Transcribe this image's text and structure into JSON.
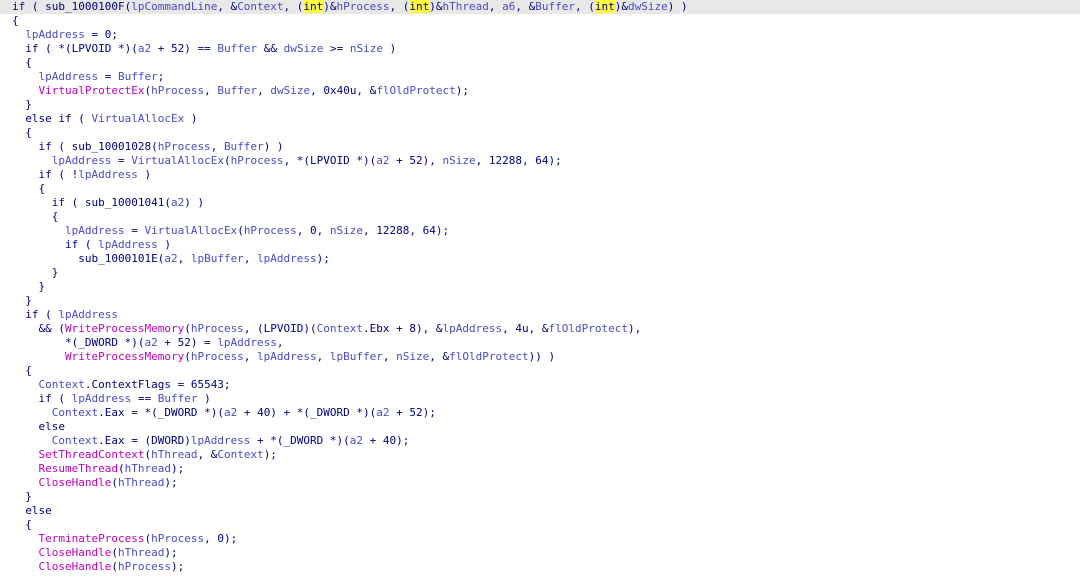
{
  "theme": {
    "background": "#ffffff",
    "current_line_bg": "#e8e8e8",
    "plain_color": "#000080",
    "var_color": "#4a4ac8",
    "func_color": "#c000c0",
    "highlight_bg": "#ffff3a"
  },
  "pseudocode": {
    "lines": [
      {
        "current": true,
        "tokens": [
          {
            "t": "if ( sub_1000100F(",
            "k": "p"
          },
          {
            "t": "lpCommandLine",
            "k": "v"
          },
          {
            "t": ", &",
            "k": "p"
          },
          {
            "t": "Context",
            "k": "v"
          },
          {
            "t": ", (",
            "k": "p"
          },
          {
            "t": "int",
            "k": "h"
          },
          {
            "t": ")&",
            "k": "p"
          },
          {
            "t": "hProcess",
            "k": "v"
          },
          {
            "t": ", (",
            "k": "p"
          },
          {
            "t": "int",
            "k": "h"
          },
          {
            "t": ")&",
            "k": "p"
          },
          {
            "t": "hThread",
            "k": "v"
          },
          {
            "t": ", ",
            "k": "p"
          },
          {
            "t": "a6",
            "k": "v"
          },
          {
            "t": ", &",
            "k": "p"
          },
          {
            "t": "Buffer",
            "k": "v"
          },
          {
            "t": ", (",
            "k": "p"
          },
          {
            "t": "int",
            "k": "h"
          },
          {
            "t": ")&",
            "k": "p"
          },
          {
            "t": "dwSize",
            "k": "v"
          },
          {
            "t": ") )",
            "k": "p"
          }
        ]
      },
      {
        "tokens": [
          {
            "t": "{",
            "k": "p"
          }
        ]
      },
      {
        "tokens": [
          {
            "t": "  ",
            "k": "p"
          },
          {
            "t": "lpAddress",
            "k": "v"
          },
          {
            "t": " = 0;",
            "k": "p"
          }
        ]
      },
      {
        "tokens": [
          {
            "t": "  if ( *(LPVOID *)(",
            "k": "p"
          },
          {
            "t": "a2",
            "k": "v"
          },
          {
            "t": " + 52) == ",
            "k": "p"
          },
          {
            "t": "Buffer",
            "k": "v"
          },
          {
            "t": " && ",
            "k": "p"
          },
          {
            "t": "dwSize",
            "k": "v"
          },
          {
            "t": " >= ",
            "k": "p"
          },
          {
            "t": "nSize",
            "k": "v"
          },
          {
            "t": " )",
            "k": "p"
          }
        ]
      },
      {
        "tokens": [
          {
            "t": "  {",
            "k": "p"
          }
        ]
      },
      {
        "tokens": [
          {
            "t": "    ",
            "k": "p"
          },
          {
            "t": "lpAddress",
            "k": "v"
          },
          {
            "t": " = ",
            "k": "p"
          },
          {
            "t": "Buffer",
            "k": "v"
          },
          {
            "t": ";",
            "k": "p"
          }
        ]
      },
      {
        "tokens": [
          {
            "t": "    ",
            "k": "p"
          },
          {
            "t": "VirtualProtectEx",
            "k": "f"
          },
          {
            "t": "(",
            "k": "p"
          },
          {
            "t": "hProcess",
            "k": "v"
          },
          {
            "t": ", ",
            "k": "p"
          },
          {
            "t": "Buffer",
            "k": "v"
          },
          {
            "t": ", ",
            "k": "p"
          },
          {
            "t": "dwSize",
            "k": "v"
          },
          {
            "t": ", 0x40u, &",
            "k": "p"
          },
          {
            "t": "flOldProtect",
            "k": "v"
          },
          {
            "t": ");",
            "k": "p"
          }
        ]
      },
      {
        "tokens": [
          {
            "t": "  }",
            "k": "p"
          }
        ]
      },
      {
        "tokens": [
          {
            "t": "  else if ( ",
            "k": "p"
          },
          {
            "t": "VirtualAllocEx",
            "k": "v"
          },
          {
            "t": " )",
            "k": "p"
          }
        ]
      },
      {
        "tokens": [
          {
            "t": "  {",
            "k": "p"
          }
        ]
      },
      {
        "tokens": [
          {
            "t": "    if ( sub_10001028(",
            "k": "p"
          },
          {
            "t": "hProcess",
            "k": "v"
          },
          {
            "t": ", ",
            "k": "p"
          },
          {
            "t": "Buffer",
            "k": "v"
          },
          {
            "t": ") )",
            "k": "p"
          }
        ]
      },
      {
        "tokens": [
          {
            "t": "      ",
            "k": "p"
          },
          {
            "t": "lpAddress",
            "k": "v"
          },
          {
            "t": " = ",
            "k": "p"
          },
          {
            "t": "VirtualAllocEx",
            "k": "v"
          },
          {
            "t": "(",
            "k": "p"
          },
          {
            "t": "hProcess",
            "k": "v"
          },
          {
            "t": ", *(LPVOID *)(",
            "k": "p"
          },
          {
            "t": "a2",
            "k": "v"
          },
          {
            "t": " + 52), ",
            "k": "p"
          },
          {
            "t": "nSize",
            "k": "v"
          },
          {
            "t": ", 12288, 64);",
            "k": "p"
          }
        ]
      },
      {
        "tokens": [
          {
            "t": "    if ( !",
            "k": "p"
          },
          {
            "t": "lpAddress",
            "k": "v"
          },
          {
            "t": " )",
            "k": "p"
          }
        ]
      },
      {
        "tokens": [
          {
            "t": "    {",
            "k": "p"
          }
        ]
      },
      {
        "tokens": [
          {
            "t": "      if ( sub_10001041(",
            "k": "p"
          },
          {
            "t": "a2",
            "k": "v"
          },
          {
            "t": ") )",
            "k": "p"
          }
        ]
      },
      {
        "tokens": [
          {
            "t": "      {",
            "k": "p"
          }
        ]
      },
      {
        "tokens": [
          {
            "t": "        ",
            "k": "p"
          },
          {
            "t": "lpAddress",
            "k": "v"
          },
          {
            "t": " = ",
            "k": "p"
          },
          {
            "t": "VirtualAllocEx",
            "k": "v"
          },
          {
            "t": "(",
            "k": "p"
          },
          {
            "t": "hProcess",
            "k": "v"
          },
          {
            "t": ", 0, ",
            "k": "p"
          },
          {
            "t": "nSize",
            "k": "v"
          },
          {
            "t": ", 12288, 64);",
            "k": "p"
          }
        ]
      },
      {
        "tokens": [
          {
            "t": "        if ( ",
            "k": "p"
          },
          {
            "t": "lpAddress",
            "k": "v"
          },
          {
            "t": " )",
            "k": "p"
          }
        ]
      },
      {
        "tokens": [
          {
            "t": "          sub_1000101E(",
            "k": "p"
          },
          {
            "t": "a2",
            "k": "v"
          },
          {
            "t": ", ",
            "k": "p"
          },
          {
            "t": "lpBuffer",
            "k": "v"
          },
          {
            "t": ", ",
            "k": "p"
          },
          {
            "t": "lpAddress",
            "k": "v"
          },
          {
            "t": ");",
            "k": "p"
          }
        ]
      },
      {
        "tokens": [
          {
            "t": "      }",
            "k": "p"
          }
        ]
      },
      {
        "tokens": [
          {
            "t": "    }",
            "k": "p"
          }
        ]
      },
      {
        "tokens": [
          {
            "t": "  }",
            "k": "p"
          }
        ]
      },
      {
        "tokens": [
          {
            "t": "  if ( ",
            "k": "p"
          },
          {
            "t": "lpAddress",
            "k": "v"
          }
        ]
      },
      {
        "tokens": [
          {
            "t": "    && (",
            "k": "p"
          },
          {
            "t": "WriteProcessMemory",
            "k": "f"
          },
          {
            "t": "(",
            "k": "p"
          },
          {
            "t": "hProcess",
            "k": "v"
          },
          {
            "t": ", (LPVOID)(",
            "k": "p"
          },
          {
            "t": "Context",
            "k": "v"
          },
          {
            "t": ".Ebx + 8), &",
            "k": "p"
          },
          {
            "t": "lpAddress",
            "k": "v"
          },
          {
            "t": ", 4u, &",
            "k": "p"
          },
          {
            "t": "flOldProtect",
            "k": "v"
          },
          {
            "t": "),",
            "k": "p"
          }
        ]
      },
      {
        "tokens": [
          {
            "t": "        *(_DWORD *)(",
            "k": "p"
          },
          {
            "t": "a2",
            "k": "v"
          },
          {
            "t": " + 52) = ",
            "k": "p"
          },
          {
            "t": "lpAddress",
            "k": "v"
          },
          {
            "t": ",",
            "k": "p"
          }
        ]
      },
      {
        "tokens": [
          {
            "t": "        ",
            "k": "p"
          },
          {
            "t": "WriteProcessMemory",
            "k": "f"
          },
          {
            "t": "(",
            "k": "p"
          },
          {
            "t": "hProcess",
            "k": "v"
          },
          {
            "t": ", ",
            "k": "p"
          },
          {
            "t": "lpAddress",
            "k": "v"
          },
          {
            "t": ", ",
            "k": "p"
          },
          {
            "t": "lpBuffer",
            "k": "v"
          },
          {
            "t": ", ",
            "k": "p"
          },
          {
            "t": "nSize",
            "k": "v"
          },
          {
            "t": ", &",
            "k": "p"
          },
          {
            "t": "flOldProtect",
            "k": "v"
          },
          {
            "t": ")) )",
            "k": "p"
          }
        ]
      },
      {
        "tokens": [
          {
            "t": "  {",
            "k": "p"
          }
        ]
      },
      {
        "tokens": [
          {
            "t": "    ",
            "k": "p"
          },
          {
            "t": "Context",
            "k": "v"
          },
          {
            "t": ".ContextFlags = 65543;",
            "k": "p"
          }
        ]
      },
      {
        "tokens": [
          {
            "t": "    if ( ",
            "k": "p"
          },
          {
            "t": "lpAddress",
            "k": "v"
          },
          {
            "t": " == ",
            "k": "p"
          },
          {
            "t": "Buffer",
            "k": "v"
          },
          {
            "t": " )",
            "k": "p"
          }
        ]
      },
      {
        "tokens": [
          {
            "t": "      ",
            "k": "p"
          },
          {
            "t": "Context",
            "k": "v"
          },
          {
            "t": ".Eax = *(_DWORD *)(",
            "k": "p"
          },
          {
            "t": "a2",
            "k": "v"
          },
          {
            "t": " + 40) + *(_DWORD *)(",
            "k": "p"
          },
          {
            "t": "a2",
            "k": "v"
          },
          {
            "t": " + 52);",
            "k": "p"
          }
        ]
      },
      {
        "tokens": [
          {
            "t": "    else",
            "k": "p"
          }
        ]
      },
      {
        "tokens": [
          {
            "t": "      ",
            "k": "p"
          },
          {
            "t": "Context",
            "k": "v"
          },
          {
            "t": ".Eax = (DWORD)",
            "k": "p"
          },
          {
            "t": "lpAddress",
            "k": "v"
          },
          {
            "t": " + *(_DWORD *)(",
            "k": "p"
          },
          {
            "t": "a2",
            "k": "v"
          },
          {
            "t": " + 40);",
            "k": "p"
          }
        ]
      },
      {
        "tokens": [
          {
            "t": "    ",
            "k": "p"
          },
          {
            "t": "SetThreadContext",
            "k": "f"
          },
          {
            "t": "(",
            "k": "p"
          },
          {
            "t": "hThread",
            "k": "v"
          },
          {
            "t": ", &",
            "k": "p"
          },
          {
            "t": "Context",
            "k": "v"
          },
          {
            "t": ");",
            "k": "p"
          }
        ]
      },
      {
        "tokens": [
          {
            "t": "    ",
            "k": "p"
          },
          {
            "t": "ResumeThread",
            "k": "f"
          },
          {
            "t": "(",
            "k": "p"
          },
          {
            "t": "hThread",
            "k": "v"
          },
          {
            "t": ");",
            "k": "p"
          }
        ]
      },
      {
        "tokens": [
          {
            "t": "    ",
            "k": "p"
          },
          {
            "t": "CloseHandle",
            "k": "f"
          },
          {
            "t": "(",
            "k": "p"
          },
          {
            "t": "hThread",
            "k": "v"
          },
          {
            "t": ");",
            "k": "p"
          }
        ]
      },
      {
        "tokens": [
          {
            "t": "  }",
            "k": "p"
          }
        ]
      },
      {
        "tokens": [
          {
            "t": "  else",
            "k": "p"
          }
        ]
      },
      {
        "tokens": [
          {
            "t": "  {",
            "k": "p"
          }
        ]
      },
      {
        "tokens": [
          {
            "t": "    ",
            "k": "p"
          },
          {
            "t": "TerminateProcess",
            "k": "f"
          },
          {
            "t": "(",
            "k": "p"
          },
          {
            "t": "hProcess",
            "k": "v"
          },
          {
            "t": ", 0);",
            "k": "p"
          }
        ]
      },
      {
        "tokens": [
          {
            "t": "    ",
            "k": "p"
          },
          {
            "t": "CloseHandle",
            "k": "f"
          },
          {
            "t": "(",
            "k": "p"
          },
          {
            "t": "hThread",
            "k": "v"
          },
          {
            "t": ");",
            "k": "p"
          }
        ]
      },
      {
        "tokens": [
          {
            "t": "    ",
            "k": "p"
          },
          {
            "t": "CloseHandle",
            "k": "f"
          },
          {
            "t": "(",
            "k": "p"
          },
          {
            "t": "hProcess",
            "k": "v"
          },
          {
            "t": ");",
            "k": "p"
          }
        ]
      }
    ]
  }
}
